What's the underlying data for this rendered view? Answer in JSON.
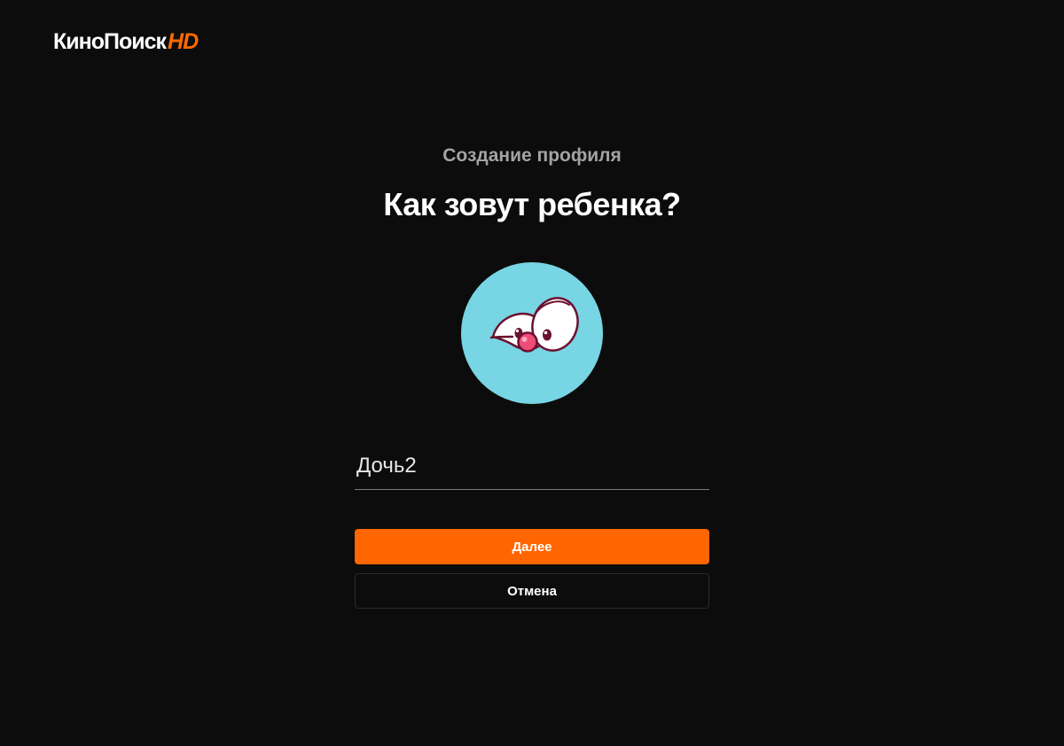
{
  "header": {
    "logo_text": "КиноПоиск",
    "logo_suffix": "HD"
  },
  "main": {
    "subtitle": "Создание профиля",
    "title": "Как зовут ребенка?",
    "avatar_icon": "cartoon-eyes-avatar",
    "name_input": {
      "value": "Дочь2"
    },
    "next_button_label": "Далее",
    "cancel_button_label": "Отмена"
  },
  "colors": {
    "background": "#0c0c0c",
    "accent": "#ff6600",
    "avatar_bg": "#78d5e3"
  }
}
